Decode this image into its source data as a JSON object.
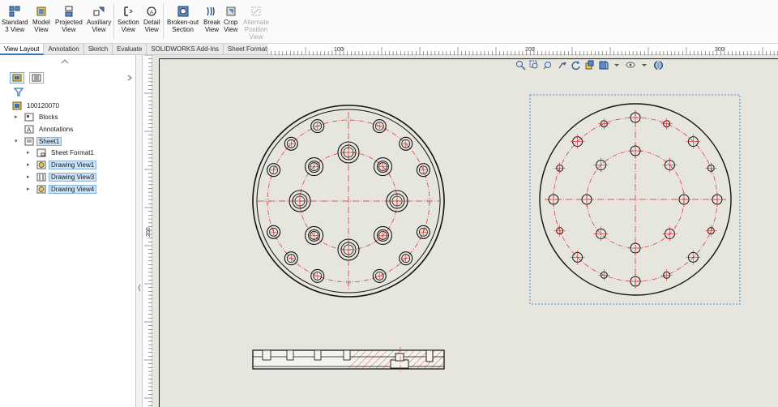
{
  "ribbon": {
    "buttons": [
      {
        "id": "standard3",
        "line1": "Standard",
        "line2": "3 View",
        "icon": "standard-3-view-icon"
      },
      {
        "id": "model",
        "line1": "Model",
        "line2": "View",
        "icon": "model-view-icon"
      },
      {
        "id": "projected",
        "line1": "Projected",
        "line2": "View",
        "icon": "projected-view-icon"
      },
      {
        "id": "auxiliary",
        "line1": "Auxiliary",
        "line2": "View",
        "icon": "auxiliary-view-icon"
      },
      {
        "id": "section",
        "line1": "Section",
        "line2": "View",
        "icon": "section-view-icon"
      },
      {
        "id": "detail",
        "line1": "Detail",
        "line2": "View",
        "icon": "detail-view-icon"
      },
      {
        "id": "brokenout",
        "line1": "Broken-out",
        "line2": "Section",
        "icon": "broken-out-section-icon"
      },
      {
        "id": "break",
        "line1": "Break",
        "line2": "View",
        "icon": "break-view-icon"
      },
      {
        "id": "crop",
        "line1": "Crop",
        "line2": "View",
        "icon": "crop-view-icon"
      },
      {
        "id": "altpos",
        "line1": "Alternate",
        "line2": "Position",
        "line3": "View",
        "icon": "alternate-position-view-icon"
      }
    ]
  },
  "tabs": [
    "View Layout",
    "Annotation",
    "Sketch",
    "Evaluate",
    "SOLIDWORKS Add-Ins",
    "Sheet Format"
  ],
  "ruler": {
    "top_labels": [
      "100",
      "200",
      "300"
    ],
    "left_labels": [
      "200"
    ]
  },
  "tree": {
    "root": "100120070",
    "items": [
      {
        "label": "Blocks",
        "icon": "blocks-icon"
      },
      {
        "label": "Annotations",
        "icon": "annotations-icon"
      },
      {
        "label": "Sheet1",
        "icon": "sheet-icon"
      },
      {
        "label": "Sheet Format1",
        "icon": "sheet-format-icon"
      },
      {
        "label": "Drawing View1",
        "icon": "drawing-view-icon"
      },
      {
        "label": "Drawing View3",
        "icon": "drawing-view-icon"
      },
      {
        "label": "Drawing View4",
        "icon": "drawing-view-icon"
      }
    ]
  },
  "colors": {
    "accent": "#2e75b6",
    "centerline": "#d42a2a",
    "selection": "#cce4f7",
    "canvas": "#e6e6df"
  }
}
